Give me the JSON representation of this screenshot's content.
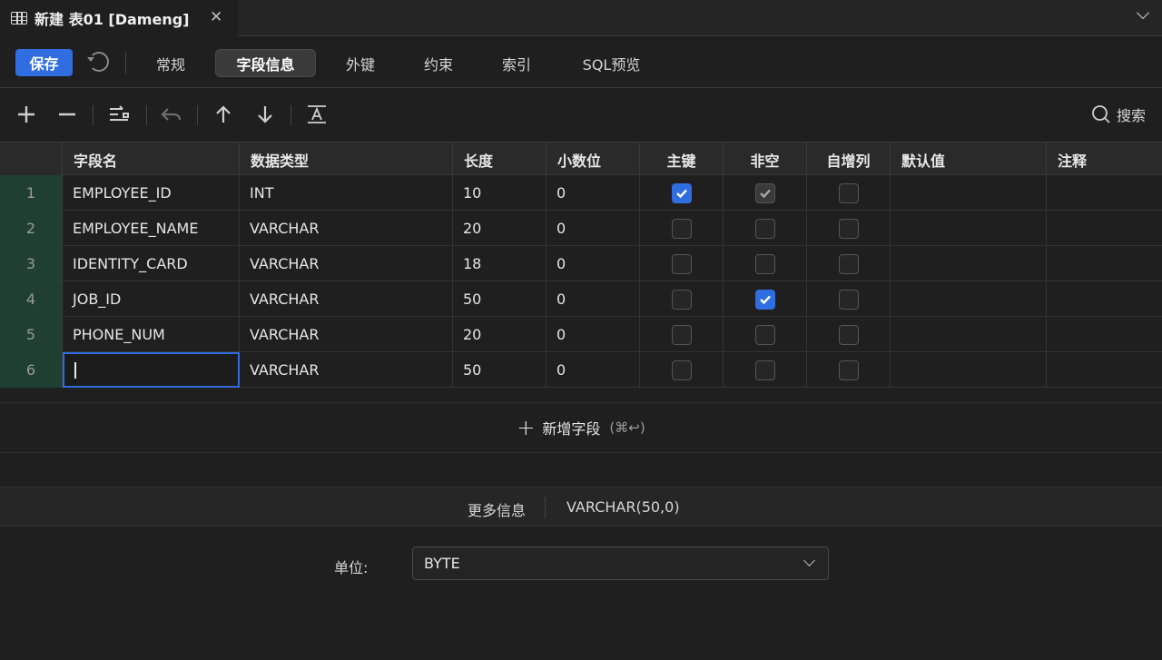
{
  "tab": {
    "title": "新建 表01 [Dameng]",
    "close": "✕"
  },
  "nav": {
    "save": "保存",
    "tabs": [
      {
        "label": "常规",
        "active": false
      },
      {
        "label": "字段信息",
        "active": true
      },
      {
        "label": "外键",
        "active": false
      },
      {
        "label": "约束",
        "active": false
      },
      {
        "label": "索引",
        "active": false
      },
      {
        "label": "SQL预览",
        "active": false
      }
    ]
  },
  "toolbar": {
    "search_label": "搜索"
  },
  "columns": [
    "字段名",
    "数据类型",
    "长度",
    "小数位",
    "主键",
    "非空",
    "自增列",
    "默认值",
    "注释"
  ],
  "rows": [
    {
      "num": "1",
      "name": "EMPLOYEE_ID",
      "type": "INT",
      "length": "10",
      "scale": "0",
      "pk": "checked",
      "notnull": "checked-dim",
      "autoinc": "none"
    },
    {
      "num": "2",
      "name": "EMPLOYEE_NAME",
      "type": "VARCHAR",
      "length": "20",
      "scale": "0",
      "pk": "none",
      "notnull": "none",
      "autoinc": "none"
    },
    {
      "num": "3",
      "name": "IDENTITY_CARD",
      "type": "VARCHAR",
      "length": "18",
      "scale": "0",
      "pk": "none",
      "notnull": "none",
      "autoinc": "none"
    },
    {
      "num": "4",
      "name": "JOB_ID",
      "type": "VARCHAR",
      "length": "50",
      "scale": "0",
      "pk": "none",
      "notnull": "checked",
      "autoinc": "none"
    },
    {
      "num": "5",
      "name": "PHONE_NUM",
      "type": "VARCHAR",
      "length": "20",
      "scale": "0",
      "pk": "none",
      "notnull": "none",
      "autoinc": "none"
    },
    {
      "num": "6",
      "name": "",
      "type": "VARCHAR",
      "length": "50",
      "scale": "0",
      "pk": "none",
      "notnull": "none",
      "autoinc": "none"
    }
  ],
  "add_field": {
    "label": "新增字段",
    "shortcut": "(⌘↩)"
  },
  "more_info": {
    "label": "更多信息",
    "type": "VARCHAR(50,0)"
  },
  "unit": {
    "label": "单位:",
    "value": "BYTE"
  },
  "colors": {
    "accent": "#2f6de0",
    "rownum_bg": "#1f3f33",
    "bg": "#1f1f1f"
  }
}
